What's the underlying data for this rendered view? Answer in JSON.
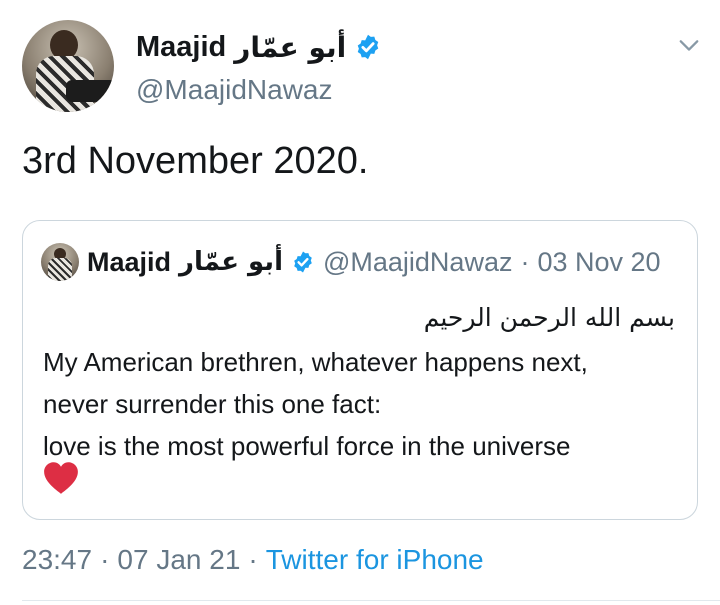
{
  "author": {
    "name_en": "Maajid",
    "name_ar": "أبو عمّار",
    "handle": "@MaajidNawaz",
    "verified": true
  },
  "tweet": {
    "text": "3rd November 2020."
  },
  "quoted": {
    "name_en": "Maajid",
    "name_ar": "أبو عمّار",
    "handle": "@MaajidNawaz",
    "date": "03 Nov 20",
    "separator": "·",
    "arabic_line": "بسم الله الرحمن الرحيم",
    "lines": [
      "My American brethren, whatever happens next,",
      "never surrender this one fact:",
      "love is the most powerful force in the universe"
    ],
    "emoji": "red-heart"
  },
  "footer": {
    "time": "23:47",
    "date": "07 Jan 21",
    "source": "Twitter for iPhone",
    "separator": "·"
  },
  "colors": {
    "text": "#14171a",
    "secondary": "#657786",
    "link": "#1b95e0",
    "verified": "#1da1f2",
    "border": "#ccd6dd",
    "heart": "#dd2e44"
  },
  "icons": [
    "verified-badge-icon",
    "chevron-down-icon",
    "red-heart-icon"
  ]
}
